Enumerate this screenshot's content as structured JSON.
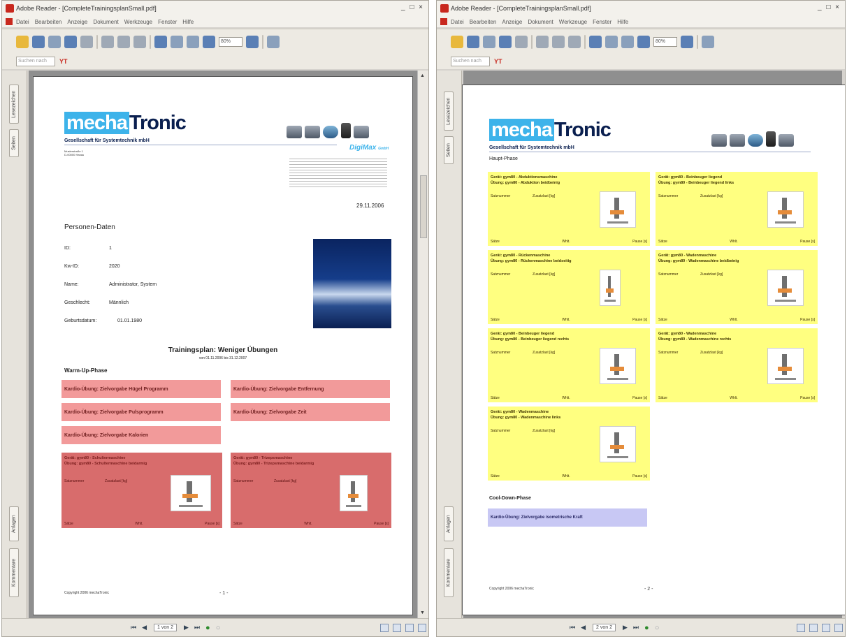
{
  "windows": [
    {
      "title": "Adobe Reader - [CompleteTrainingsplanSmall.pdf]",
      "page_indicator": "1 von 2"
    },
    {
      "title": "Adobe Reader - [CompleteTrainingsplanSmall.pdf]",
      "page_indicator": "2 von 2"
    }
  ],
  "menu": [
    "Datei",
    "Bearbeiten",
    "Anzeige",
    "Dokument",
    "Werkzeuge",
    "Fenster",
    "Hilfe"
  ],
  "window_controls": "_ □ ×",
  "toolbar": {
    "zoom": "80%"
  },
  "find": {
    "placeholder": "Suchen nach",
    "icon": "YT"
  },
  "side_tabs": [
    "Lesezeichen",
    "Seiten",
    "Anlagen",
    "Kommentare"
  ],
  "brand": {
    "logo_part1": "mecha",
    "logo_part2": "Tronic",
    "tagline": "Gesellschaft für Systemtechnik mbH",
    "address": [
      "Musterstraße 1",
      "D-00000 Hanau"
    ],
    "partner": "DigiMax",
    "partner_sub": "GmbH"
  },
  "page1": {
    "date": "29.11.2006",
    "personal_header": "Personen-Daten",
    "fields": [
      {
        "label": "ID:",
        "value": "1"
      },
      {
        "label": "Kw-ID:",
        "value": "2020"
      },
      {
        "label": "Name:",
        "value": "Administrator, System"
      },
      {
        "label": "Geschlecht:",
        "value": "Männlich"
      },
      {
        "label": "Geburtsdatum:",
        "value": "01.01.1980"
      }
    ],
    "plan_title": "Trainingsplan: Weniger Übungen",
    "plan_range": "von 01.11.2006 bis 31.12.2007",
    "warmup_header": "Warm-Up-Phase",
    "cardio": [
      "Kardio-Übung: Zielvorgabe Hügel Programm",
      "Kardio-Übung: Zielvorgabe Entfernung",
      "Kardio-Übung: Zielvorgabe Pulsprogramm",
      "Kardio-Übung: Zielvorgabe Zeit",
      "Kardio-Übung: Zielvorgabe Kalorien"
    ],
    "cards": [
      {
        "title1": "Gerät: gym80 - Schultermaschine",
        "title2": "Übung: gym80 - Schultermaschine beidarmig"
      },
      {
        "title1": "Gerät: gym80 - Trizepsmaschine",
        "title2": "Übung: gym80 - Trizepsmaschine beidarmig"
      }
    ],
    "footer_copy": "Copyright 2006 mechaTronic",
    "page_num": "- 1 -"
  },
  "page2": {
    "main_header": "Haupt-Phase",
    "cards": [
      {
        "title1": "Gerät: gym80 - Abduktionsmaschine",
        "title2": "Übung: gym80 - Abduktion beidbeinig"
      },
      {
        "title1": "Gerät: gym80 - Beinbeuger liegend",
        "title2": "Übung: gym80 - Beinbeuger liegend links"
      },
      {
        "title1": "Gerät: gym80 - Rückenmaschine",
        "title2": "Übung: gym80 - Rückenmaschine beidseitig"
      },
      {
        "title1": "Gerät: gym80 - Wadenmaschine",
        "title2": "Übung: gym80 - Wadenmaschine beidbeinig"
      },
      {
        "title1": "Gerät: gym80 - Beinbeuger liegend",
        "title2": "Übung: gym80 - Beinbeuger liegend rechts"
      },
      {
        "title1": "Gerät: gym80 - Wadenmaschine",
        "title2": "Übung: gym80 - Wadenmaschine rechts"
      },
      {
        "title1": "Gerät: gym80 - Wadenmaschine",
        "title2": "Übung: gym80 - Wadenmaschine links"
      }
    ],
    "cooldown_header": "Cool-Down-Phase",
    "cooldown_item": "Kardio-Übung: Zielvorgabe isometrische Kraft",
    "footer_copy": "Copyright 2006 mechaTronic",
    "page_num": "- 2 -"
  },
  "card_labels": {
    "sets": "Satznummer",
    "weight": "Zusatzlast [kg]",
    "footer_sets": "Sätze",
    "footer_reps": "Whlt.",
    "footer_pause": "Pause [s]"
  }
}
